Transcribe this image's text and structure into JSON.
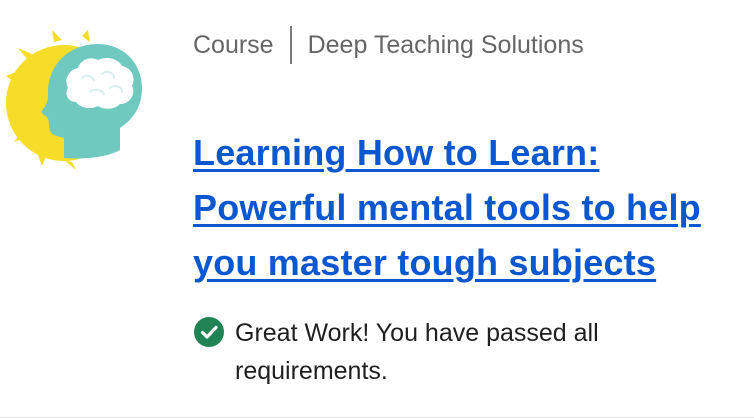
{
  "course": {
    "type_label": "Course",
    "provider": "Deep Teaching Solutions",
    "title": "Learning How to Learn: Powerful mental tools to help you master tough subjects",
    "status_message": "Great Work! You have passed all requirements."
  },
  "colors": {
    "link": "#0b57d0",
    "success_green": "#1f8354",
    "logo_sun": "#f5dd2a",
    "logo_head": "#6fc9bf",
    "logo_brain": "#ffffff"
  },
  "icons": {
    "logo": "course-logo-icon",
    "success": "checkmark-circle-icon"
  }
}
